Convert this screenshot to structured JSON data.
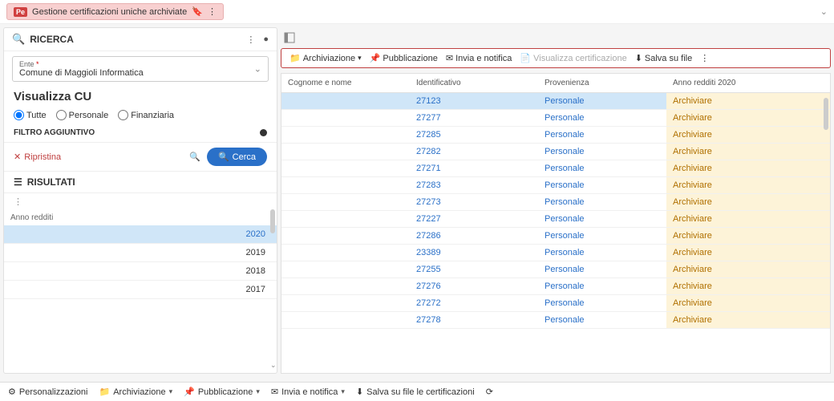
{
  "breadcrumb": {
    "badge": "Pe",
    "title": "Gestione certificazioni uniche archiviate"
  },
  "search": {
    "header": "RICERCA",
    "ente_label": "Ente",
    "ente_value": "Comune di Maggioli Informatica",
    "visualizza_title": "Visualizza CU",
    "radios": {
      "tutte": "Tutte",
      "personale": "Personale",
      "finanziaria": "Finanziaria"
    },
    "filtro": "FILTRO AGGIUNTIVO",
    "ripristina": "Ripristina",
    "cerca": "Cerca"
  },
  "results": {
    "header": "RISULTATI",
    "col_anno": "Anno redditi",
    "years": [
      "2020",
      "2019",
      "2018",
      "2017"
    ]
  },
  "toolbar": {
    "archiviazione": "Archiviazione",
    "pubblicazione": "Pubblicazione",
    "invia": "Invia e notifica",
    "visualizza_cert": "Visualizza certificazione",
    "salva": "Salva su file"
  },
  "table": {
    "headers": {
      "cognome": "Cognome e nome",
      "identificativo": "Identificativo",
      "provenienza": "Provenienza",
      "anno": "Anno redditi 2020"
    },
    "rows": [
      {
        "id": "27123",
        "prov": "Personale",
        "anno": "Archiviare",
        "selected": true
      },
      {
        "id": "27277",
        "prov": "Personale",
        "anno": "Archiviare"
      },
      {
        "id": "27285",
        "prov": "Personale",
        "anno": "Archiviare"
      },
      {
        "id": "27282",
        "prov": "Personale",
        "anno": "Archiviare"
      },
      {
        "id": "27271",
        "prov": "Personale",
        "anno": "Archiviare"
      },
      {
        "id": "27283",
        "prov": "Personale",
        "anno": "Archiviare"
      },
      {
        "id": "27273",
        "prov": "Personale",
        "anno": "Archiviare"
      },
      {
        "id": "27227",
        "prov": "Personale",
        "anno": "Archiviare"
      },
      {
        "id": "27286",
        "prov": "Personale",
        "anno": "Archiviare"
      },
      {
        "id": "23389",
        "prov": "Personale",
        "anno": "Archiviare"
      },
      {
        "id": "27255",
        "prov": "Personale",
        "anno": "Archiviare"
      },
      {
        "id": "27276",
        "prov": "Personale",
        "anno": "Archiviare"
      },
      {
        "id": "27272",
        "prov": "Personale",
        "anno": "Archiviare"
      },
      {
        "id": "27278",
        "prov": "Personale",
        "anno": "Archiviare"
      }
    ]
  },
  "footer": {
    "personalizzazioni": "Personalizzazioni",
    "archiviazione": "Archiviazione",
    "pubblicazione": "Pubblicazione",
    "invia": "Invia e notifica",
    "salva": "Salva su file le certificazioni"
  }
}
